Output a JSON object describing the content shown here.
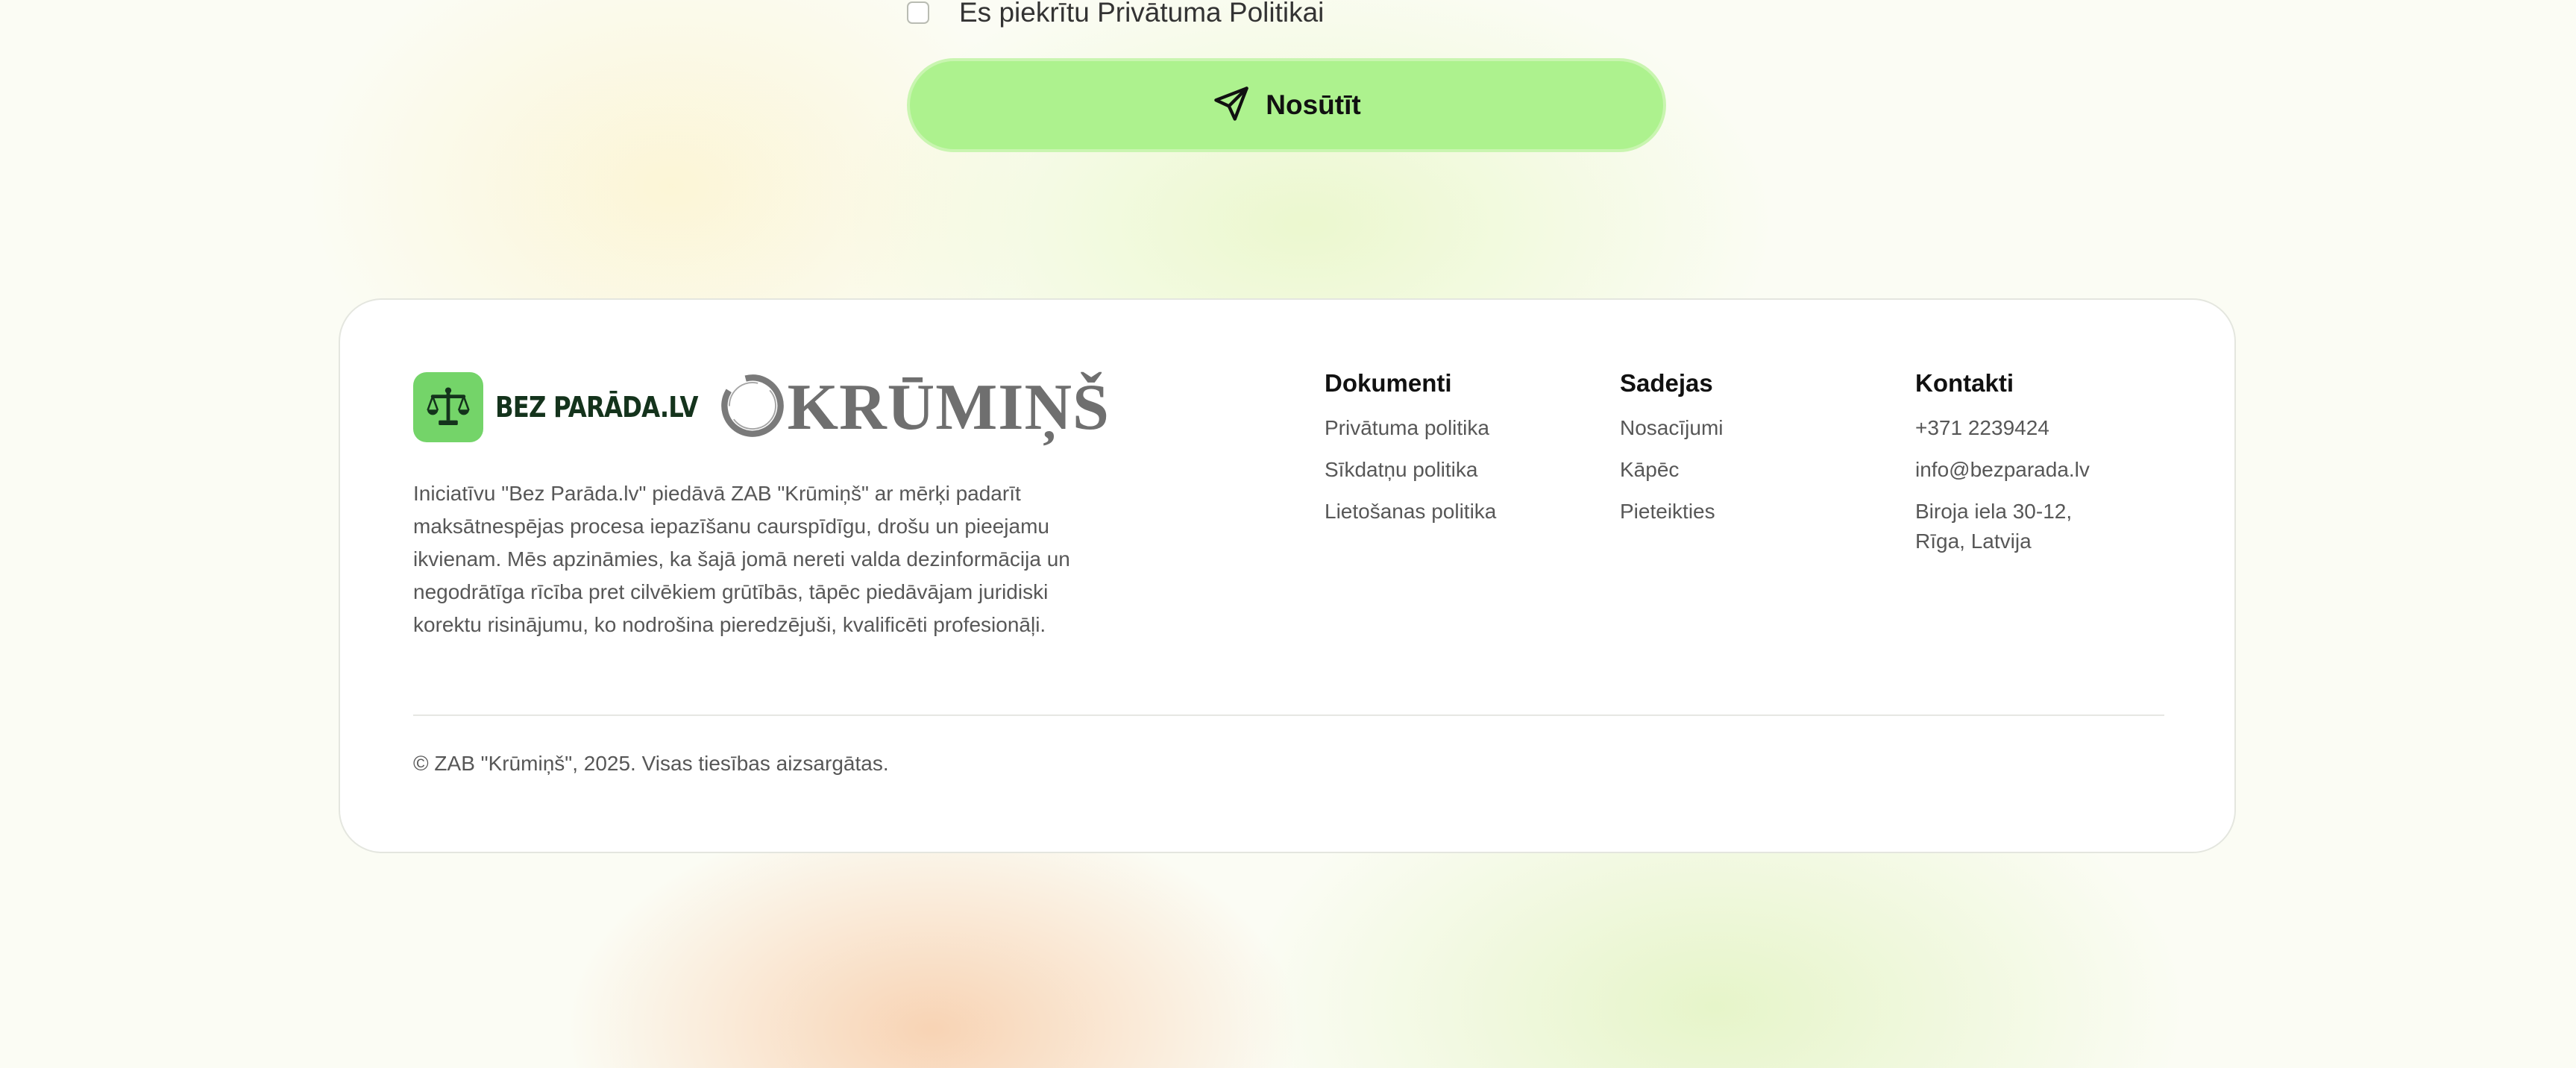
{
  "consent": {
    "label": "Es piekrītu Privātuma Politikai",
    "checked": false
  },
  "submit": {
    "label": "Nosūtīt",
    "icon": "send-icon"
  },
  "footer": {
    "brand": {
      "bezparada_logo": {
        "text": "BEZ PARĀDA.LV",
        "icon": "scales-icon",
        "tile_color": "#74d469"
      },
      "krumins_logo": {
        "text": "KRŪMIŅŠ",
        "icon": "ring-icon"
      }
    },
    "description": "Iniciatīvu \"Bez Parāda.lv\" piedāvā ZAB \"Krūmiņš\" ar mērķi padarīt maksātnespējas procesa iepazīšanu caurspīdīgu, drošu un pieejamu ikvienam. Mēs apzināmies, ka šajā jomā nereti valda dezinformācija un negodrātīga rīcība pret cilvēkiem grūtībās, tāpēc piedāvājam juridiski korektu risinājumu, ko nodrošina pieredzējuši, kvalificēti profesionāļi.",
    "columns": {
      "dokumenti": {
        "title": "Dokumenti",
        "links": [
          "Privātuma politika",
          "Sīkdatņu politika",
          "Lietošanas politika"
        ]
      },
      "sadejas": {
        "title": "Sadejas",
        "links": [
          "Nosacījumi",
          "Kāpēc",
          "Pieteikties"
        ]
      },
      "kontakti": {
        "title": "Kontakti",
        "phone": "+371 2239424",
        "email": "info@bezparada.lv",
        "address_line1": "Biroja iela 30-12,",
        "address_line2": "Rīga, Latvija"
      }
    },
    "copyright": "© ZAB \"Krūmiņš\", 2025. Visas tiesības aizsargātas."
  },
  "colors": {
    "accent_button": "#adf28e",
    "logo_text_dark": "#14331c"
  }
}
